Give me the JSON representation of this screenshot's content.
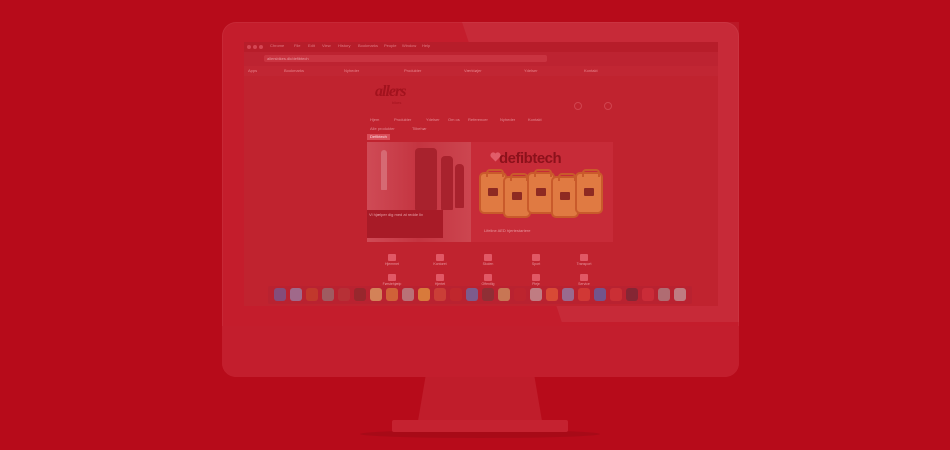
{
  "browser": {
    "menu_items": [
      "Chrome",
      "File",
      "Edit",
      "View",
      "History",
      "Bookmarks",
      "People",
      "Window",
      "Help"
    ],
    "address": "allersbikes.dk/defibtech",
    "bookmarks": [
      "Apps",
      "Bookmarks",
      "Nyheder",
      "Produkter",
      "Værktøjer",
      "Ydelser",
      "Kontakt"
    ]
  },
  "site": {
    "logo": "allers",
    "logo_sub": "bikes",
    "nav_items": [
      "Hjem",
      "Produkter",
      "Ydelser",
      "Om os",
      "Referencer",
      "Nyheder",
      "Kontakt"
    ],
    "sub_nav": [
      "Alle produkter",
      "Tilbehør"
    ],
    "tag": "Defibtech",
    "banner": {
      "brand": "defibtech",
      "caption": "Vi hjælper dig med at redde liv",
      "tagline": "Lifeline AED hjertestartere"
    },
    "features": [
      {
        "icon": "home-icon",
        "label": "Hjemmet"
      },
      {
        "icon": "office-icon",
        "label": "Kontoret"
      },
      {
        "icon": "school-icon",
        "label": "Skolen"
      },
      {
        "icon": "sport-icon",
        "label": "Sport"
      },
      {
        "icon": "transport-icon",
        "label": "Transport"
      },
      {
        "icon": "first-aid-icon",
        "label": "Førstehjælp"
      },
      {
        "icon": "heart-icon",
        "label": "Hjertet"
      },
      {
        "icon": "people-icon",
        "label": "Offentlig"
      },
      {
        "icon": "wheelchair-icon",
        "label": "Pleje"
      },
      {
        "icon": "support-icon",
        "label": "Service"
      }
    ]
  },
  "dock": {
    "icon_colors": [
      "#5a6fb8",
      "#8da4d6",
      "#c84a2a",
      "#8b8b8b",
      "#b63d3d",
      "#7d2b2b",
      "#ead27a",
      "#e4963f",
      "#b9b2b2",
      "#f3c246",
      "#d9553e",
      "#c72c2c",
      "#4c8bd8",
      "#6e3a3a",
      "#d6bb73",
      "#c1272d",
      "#c6c6c6",
      "#f26b3a",
      "#7fa6de",
      "#e64a3a",
      "#3b7dd8",
      "#d93a3a",
      "#5b2a38",
      "#d93440",
      "#a9a9a9",
      "#c4c4c4"
    ]
  },
  "colors": {
    "background": "#b70b1a",
    "screen": "#c0222f",
    "accent": "#e07a42"
  }
}
